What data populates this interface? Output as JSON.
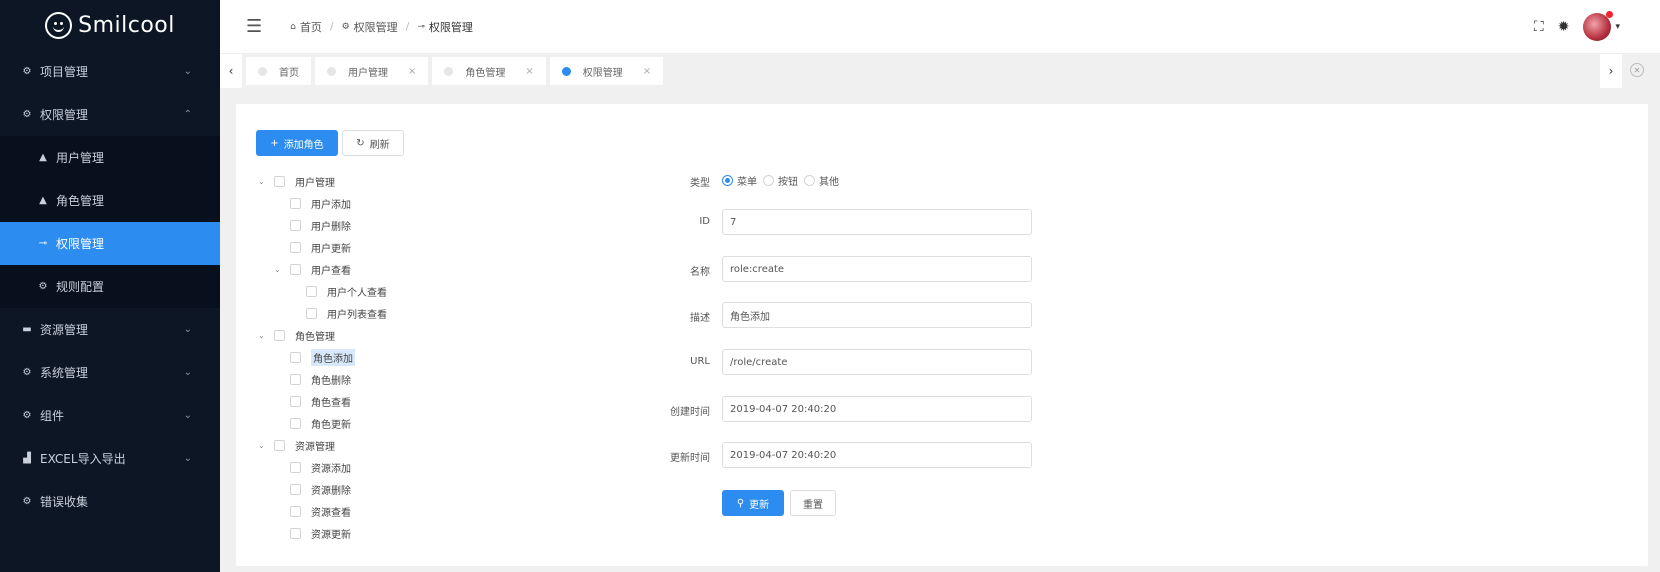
{
  "brand": {
    "name": "Smilcool"
  },
  "sidebar": {
    "items": [
      {
        "label": "项目管理",
        "icon": "gear-icon",
        "glyph": "⚙",
        "expanded": false
      },
      {
        "label": "权限管理",
        "icon": "gear-icon",
        "glyph": "⚙",
        "expanded": true,
        "children": [
          {
            "label": "用户管理",
            "icon": "user-icon",
            "glyph": "👤"
          },
          {
            "label": "角色管理",
            "icon": "user-group-icon",
            "glyph": "👥"
          },
          {
            "label": "权限管理",
            "icon": "key-icon",
            "glyph": "⊸",
            "active": true
          },
          {
            "label": "规则配置",
            "icon": "gear-icon",
            "glyph": "⚙"
          }
        ]
      },
      {
        "label": "资源管理",
        "icon": "folder-icon",
        "glyph": "▬",
        "expanded": false
      },
      {
        "label": "系统管理",
        "icon": "gear-icon",
        "glyph": "⚙",
        "expanded": false
      },
      {
        "label": "组件",
        "icon": "gear-icon",
        "glyph": "⚙",
        "expanded": false
      },
      {
        "label": "EXCEL导入导出",
        "icon": "chart-icon",
        "glyph": "▟",
        "expanded": false
      },
      {
        "label": "错误收集",
        "icon": "bug-icon",
        "glyph": "⚙"
      }
    ]
  },
  "header": {
    "breadcrumb": [
      {
        "label": "首页",
        "icon": "home-icon",
        "glyph": "⌂"
      },
      {
        "label": "权限管理",
        "icon": "gear-icon",
        "glyph": "⚙"
      },
      {
        "label": "权限管理",
        "icon": "key-icon",
        "glyph": "⊸"
      }
    ],
    "separator": "/"
  },
  "tabs": [
    {
      "label": "首页",
      "closable": false
    },
    {
      "label": "用户管理",
      "closable": true
    },
    {
      "label": "角色管理",
      "closable": true
    },
    {
      "label": "权限管理",
      "closable": true,
      "active": true
    }
  ],
  "toolbar": {
    "add_label": "添加角色",
    "refresh_label": "刷新"
  },
  "tree": [
    {
      "label": "用户管理",
      "level": 0,
      "expandable": true
    },
    {
      "label": "用户添加",
      "level": 1
    },
    {
      "label": "用户删除",
      "level": 1
    },
    {
      "label": "用户更新",
      "level": 1
    },
    {
      "label": "用户查看",
      "level": 1,
      "expandable": true
    },
    {
      "label": "用户个人查看",
      "level": 2
    },
    {
      "label": "用户列表查看",
      "level": 2
    },
    {
      "label": "角色管理",
      "level": 0,
      "expandable": true
    },
    {
      "label": "角色添加",
      "level": 1,
      "selected": true
    },
    {
      "label": "角色删除",
      "level": 1
    },
    {
      "label": "角色查看",
      "level": 1
    },
    {
      "label": "角色更新",
      "level": 1
    },
    {
      "label": "资源管理",
      "level": 0,
      "expandable": true
    },
    {
      "label": "资源添加",
      "level": 1
    },
    {
      "label": "资源删除",
      "level": 1
    },
    {
      "label": "资源查看",
      "level": 1
    },
    {
      "label": "资源更新",
      "level": 1
    }
  ],
  "form": {
    "type_label": "类型",
    "type_options": [
      "菜单",
      "按钮",
      "其他"
    ],
    "type_selected": "菜单",
    "id_label": "ID",
    "id_value": "7",
    "name_label": "名称",
    "name_value": "role:create",
    "desc_label": "描述",
    "desc_value": "角色添加",
    "url_label": "URL",
    "url_value": "/role/create",
    "created_label": "创建时间",
    "created_value": "2019-04-07 20:40:20",
    "updated_label": "更新时间",
    "updated_value": "2019-04-07 20:40:20",
    "update_button": "更新",
    "reset_button": "重置"
  },
  "colors": {
    "primary": "#2d8cf0",
    "sidebar_bg": "#0c1624",
    "badge": "#f5222d"
  }
}
